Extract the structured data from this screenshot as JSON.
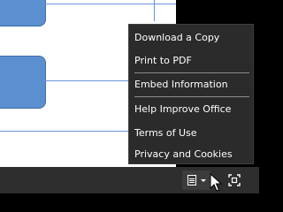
{
  "menu": {
    "items": [
      {
        "label": "Download a Copy"
      },
      {
        "label": "Print to PDF"
      },
      {
        "label": "Embed Information"
      },
      {
        "label": "Help Improve Office"
      },
      {
        "label": "Terms of Use"
      },
      {
        "label": "Privacy and Cookies"
      }
    ]
  },
  "statusbar": {
    "share_icon": "document-menu-icon",
    "fit_icon": "fit-to-screen-icon"
  },
  "colors": {
    "menu_bg": "#2b2b2b",
    "menu_text": "#ffffff",
    "statusbar_bg": "#2e2e2e",
    "shape_fill": "#5b8fcf",
    "connector": "#6b94d6"
  }
}
